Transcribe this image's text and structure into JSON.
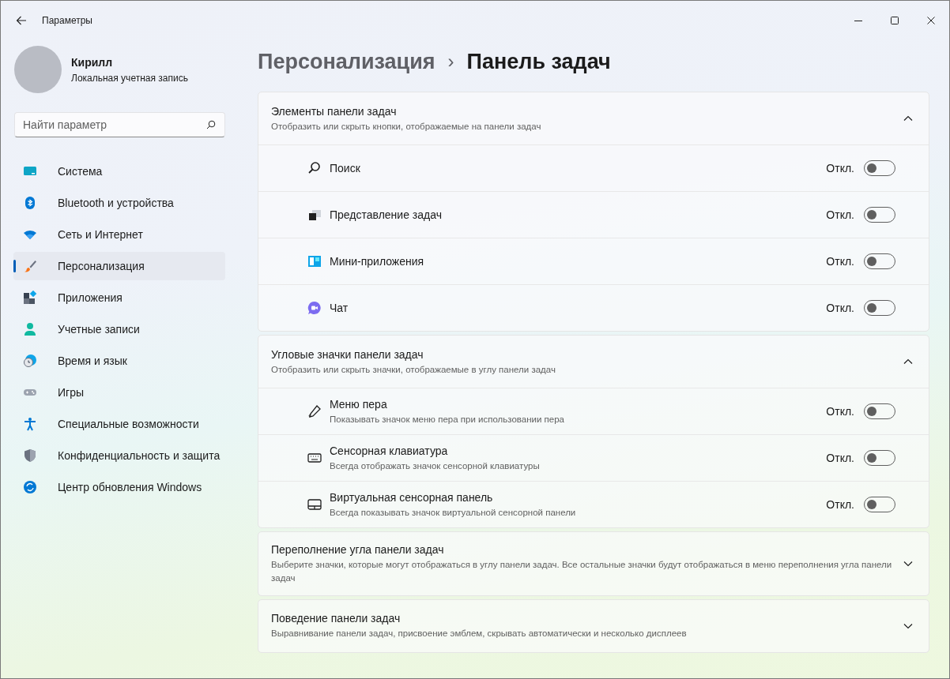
{
  "window": {
    "title": "Параметры"
  },
  "user": {
    "name": "Кирилл",
    "account": "Локальная учетная запись"
  },
  "search": {
    "placeholder": "Найти параметр"
  },
  "nav": [
    {
      "kind": "system",
      "label": "Система",
      "selected": false
    },
    {
      "kind": "bluetooth",
      "label": "Bluetooth и устройства",
      "selected": false
    },
    {
      "kind": "network",
      "label": "Сеть и Интернет",
      "selected": false
    },
    {
      "kind": "personalization",
      "label": "Персонализация",
      "selected": true
    },
    {
      "kind": "apps",
      "label": "Приложения",
      "selected": false
    },
    {
      "kind": "accounts",
      "label": "Учетные записи",
      "selected": false
    },
    {
      "kind": "time",
      "label": "Время и язык",
      "selected": false
    },
    {
      "kind": "gaming",
      "label": "Игры",
      "selected": false
    },
    {
      "kind": "accessibility",
      "label": "Специальные возможности",
      "selected": false
    },
    {
      "kind": "privacy",
      "label": "Конфиденциальность и защита",
      "selected": false
    },
    {
      "kind": "update",
      "label": "Центр обновления Windows",
      "selected": false
    }
  ],
  "breadcrumb": {
    "parent": "Персонализация",
    "separator": "›",
    "current": "Панель задач"
  },
  "sections": [
    {
      "title": "Элементы панели задач",
      "subtitle": "Отобразить или скрыть кнопки, отображаемые на панели задач",
      "expanded": true,
      "items": [
        {
          "kind": "search",
          "label": "Поиск",
          "state": "Откл.",
          "on": false
        },
        {
          "kind": "taskview",
          "label": "Представление задач",
          "state": "Откл.",
          "on": false
        },
        {
          "kind": "widgets",
          "label": "Мини-приложения",
          "state": "Откл.",
          "on": false
        },
        {
          "kind": "chat",
          "label": "Чат",
          "state": "Откл.",
          "on": false
        }
      ]
    },
    {
      "title": "Угловые значки панели задач",
      "subtitle": "Отобразить или скрыть значки, отображаемые в углу панели задач",
      "expanded": true,
      "items": [
        {
          "kind": "pen",
          "label": "Меню пера",
          "description": "Показывать значок меню пера при использовании пера",
          "state": "Откл.",
          "on": false
        },
        {
          "kind": "keyboard",
          "label": "Сенсорная клавиатура",
          "description": "Всегда отображать значок сенсорной клавиатуры",
          "state": "Откл.",
          "on": false
        },
        {
          "kind": "touchpad",
          "label": "Виртуальная сенсорная панель",
          "description": "Всегда показывать значок виртуальной сенсорной панели",
          "state": "Откл.",
          "on": false
        }
      ]
    },
    {
      "title": "Переполнение угла панели задач",
      "subtitle": "Выберите значки, которые могут отображаться в углу панели задач. Все остальные значки будут отображаться в меню переполнения угла панели задач",
      "expanded": false
    },
    {
      "title": "Поведение панели задач",
      "subtitle": "Выравнивание панели задач, присвоение эмблем, скрывать автоматически и несколько дисплеев",
      "expanded": false
    }
  ]
}
